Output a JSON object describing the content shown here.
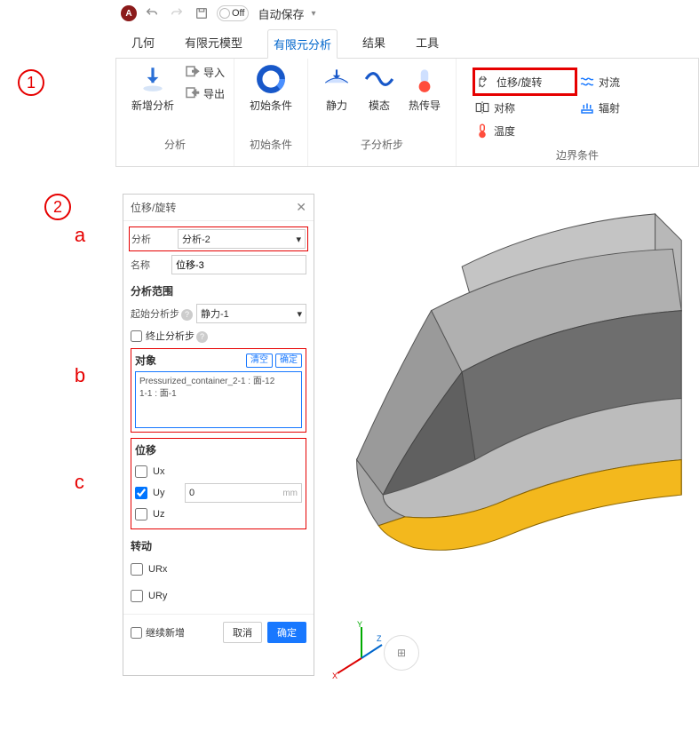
{
  "topbar": {
    "toggle_label": "Off",
    "autosave": "自动保存"
  },
  "tabs": [
    "几何",
    "有限元模型",
    "有限元分析",
    "结果",
    "工具"
  ],
  "active_tab": 2,
  "ribbon": {
    "group1": {
      "title": "分析",
      "new_analysis": "新增分析",
      "import": "导入",
      "export": "导出"
    },
    "group2": {
      "title": "初始条件",
      "initial": "初始条件"
    },
    "group3": {
      "title": "子分析步",
      "static": "静力",
      "modal": "模态",
      "heat": "热传导"
    },
    "group4": {
      "title": "边界条件",
      "disp_rot": "位移/旋转",
      "convection": "对流",
      "symmetry": "对称",
      "radiation": "辐射",
      "temperature": "温度"
    }
  },
  "annotations": {
    "n1": "1",
    "n2": "2",
    "a": "a",
    "b": "b",
    "c": "c"
  },
  "panel": {
    "title": "位移/旋转",
    "analysis_label": "分析",
    "analysis_value": "分析-2",
    "name_label": "名称",
    "name_value": "位移-3",
    "scope_title": "分析范围",
    "start_step_label": "起始分析步",
    "start_step_value": "静力-1",
    "end_step_label": "终止分析步",
    "object_title": "对象",
    "clear": "清空",
    "confirm_small": "确定",
    "object_text": "Pressurized_container_2-1 : 面-12\n1-1 : 面-1",
    "disp_title": "位移",
    "ux": "Ux",
    "uy": "Uy",
    "uz": "Uz",
    "uy_value": "0",
    "uy_unit": "mm",
    "rot_title": "转动",
    "urx": "URx",
    "ury": "URy",
    "continue_add": "继续新增",
    "cancel": "取消",
    "ok": "确定"
  },
  "axis": {
    "x": "X",
    "y": "Y",
    "z": "Z"
  }
}
